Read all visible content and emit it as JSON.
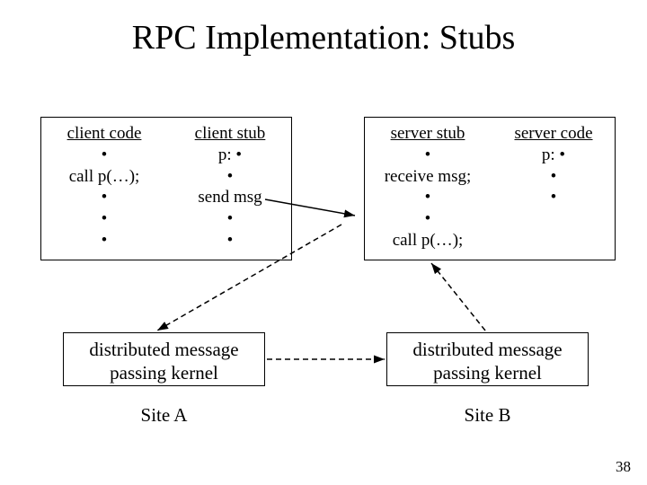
{
  "title": "RPC Implementation: Stubs",
  "left": {
    "clientCode": {
      "hdr": "client code",
      "l1": "•",
      "l2": "call p(…);",
      "l3": "•",
      "l4": "•",
      "l5": "•"
    },
    "clientStub": {
      "hdr": "client stub",
      "l1": "p:  •",
      "l2": "•",
      "l3": "send msg",
      "l4": "•",
      "l5": "•"
    },
    "kernel": {
      "l1": "distributed message",
      "l2": "passing kernel"
    },
    "site": "Site A"
  },
  "right": {
    "serverStub": {
      "hdr": "server stub",
      "l1": "•",
      "l2": "receive msg;",
      "l3": "•",
      "l4": "•",
      "l5": "call p(…);"
    },
    "serverCode": {
      "hdr": "server code",
      "l1": "p:  •",
      "l2": "•",
      "l3": "•"
    },
    "kernel": {
      "l1": "distributed message",
      "l2": "passing kernel"
    },
    "site": "Site B"
  },
  "page": "38"
}
